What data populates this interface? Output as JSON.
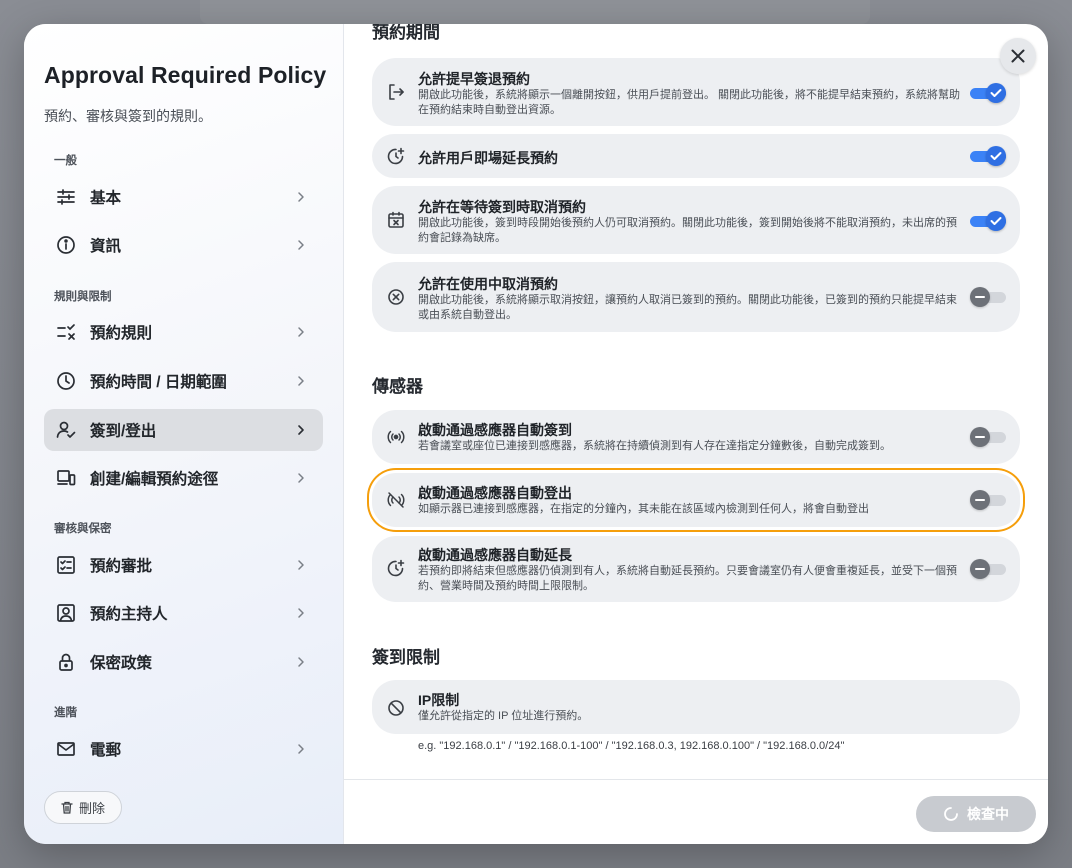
{
  "sidebar": {
    "title": "Approval Required Policy",
    "subtitle": "預約、審核與簽到的規則。",
    "sections": {
      "general": "一般",
      "rules": "規則與限制",
      "approval": "審核與保密",
      "advanced": "進階"
    },
    "items": {
      "basic": "基本",
      "info": "資訊",
      "booking_rules": "預約規則",
      "booking_time": "預約時間 / 日期範圍",
      "checkin": "簽到/登出",
      "create_edit": "創建/編輯預約途徑",
      "approval": "預約審批",
      "host": "預約主持人",
      "privacy": "保密政策",
      "email": "電郵"
    },
    "delete_label": "刪除"
  },
  "main": {
    "booking_period_title": "預約期間",
    "cards": {
      "early_checkout": {
        "title": "允許提早簽退預約",
        "desc": "開啟此功能後，系統將顯示一個離開按鈕，供用戶提前登出。 關閉此功能後，將不能提早結束預約，系統將幫助在預約結束時自動登出資源。",
        "enabled": true
      },
      "extend": {
        "title": "允許用戶即場延長預約",
        "enabled": true
      },
      "cancel_waiting": {
        "title": "允許在等待簽到時取消預約",
        "desc": "開啟此功能後，簽到時段開始後預約人仍可取消預約。關閉此功能後，簽到開始後將不能取消預約，未出席的預約會記錄為缺席。",
        "enabled": true
      },
      "cancel_in_use": {
        "title": "允許在使用中取消預約",
        "desc": "開啟此功能後，系統將顯示取消按鈕，讓預約人取消已簽到的預約。關閉此功能後，已簽到的預約只能提早結束或由系統自動登出。",
        "enabled": false
      },
      "sensor_checkin": {
        "title": "啟動通過感應器自動簽到",
        "desc": "若會議室或座位已連接到感應器，系統將在持續偵測到有人存在達指定分鐘數後，自動完成簽到。",
        "enabled": false
      },
      "sensor_checkout": {
        "title": "啟動通過感應器自動登出",
        "desc": "如顯示器已連接到感應器，在指定的分鐘內，其未能在該區域內檢測到任何人，將會自動登出",
        "enabled": false
      },
      "sensor_extend": {
        "title": "啟動通過感應器自動延長",
        "desc": "若預約即將結束但感應器仍偵測到有人，系統將自動延長預約。只要會議室仍有人便會重複延長，並受下一個預約、營業時間及預約時間上限限制。",
        "enabled": false
      },
      "ip_limit": {
        "title": "IP限制",
        "desc": "僅允許從指定的 IP 位址進行預約。"
      }
    },
    "sensor_title": "傳感器",
    "checkin_limit_title": "簽到限制",
    "ip_hint": "e.g. \"192.168.0.1\" / \"192.168.0.1-100\" / \"192.168.0.3, 192.168.0.100\" / \"192.168.0.0/24\""
  },
  "footer": {
    "check_label": "檢查中"
  },
  "colors": {
    "accent": "#3b82f6",
    "focus_ring": "#f59e0b",
    "card_bg": "#edeff2"
  }
}
